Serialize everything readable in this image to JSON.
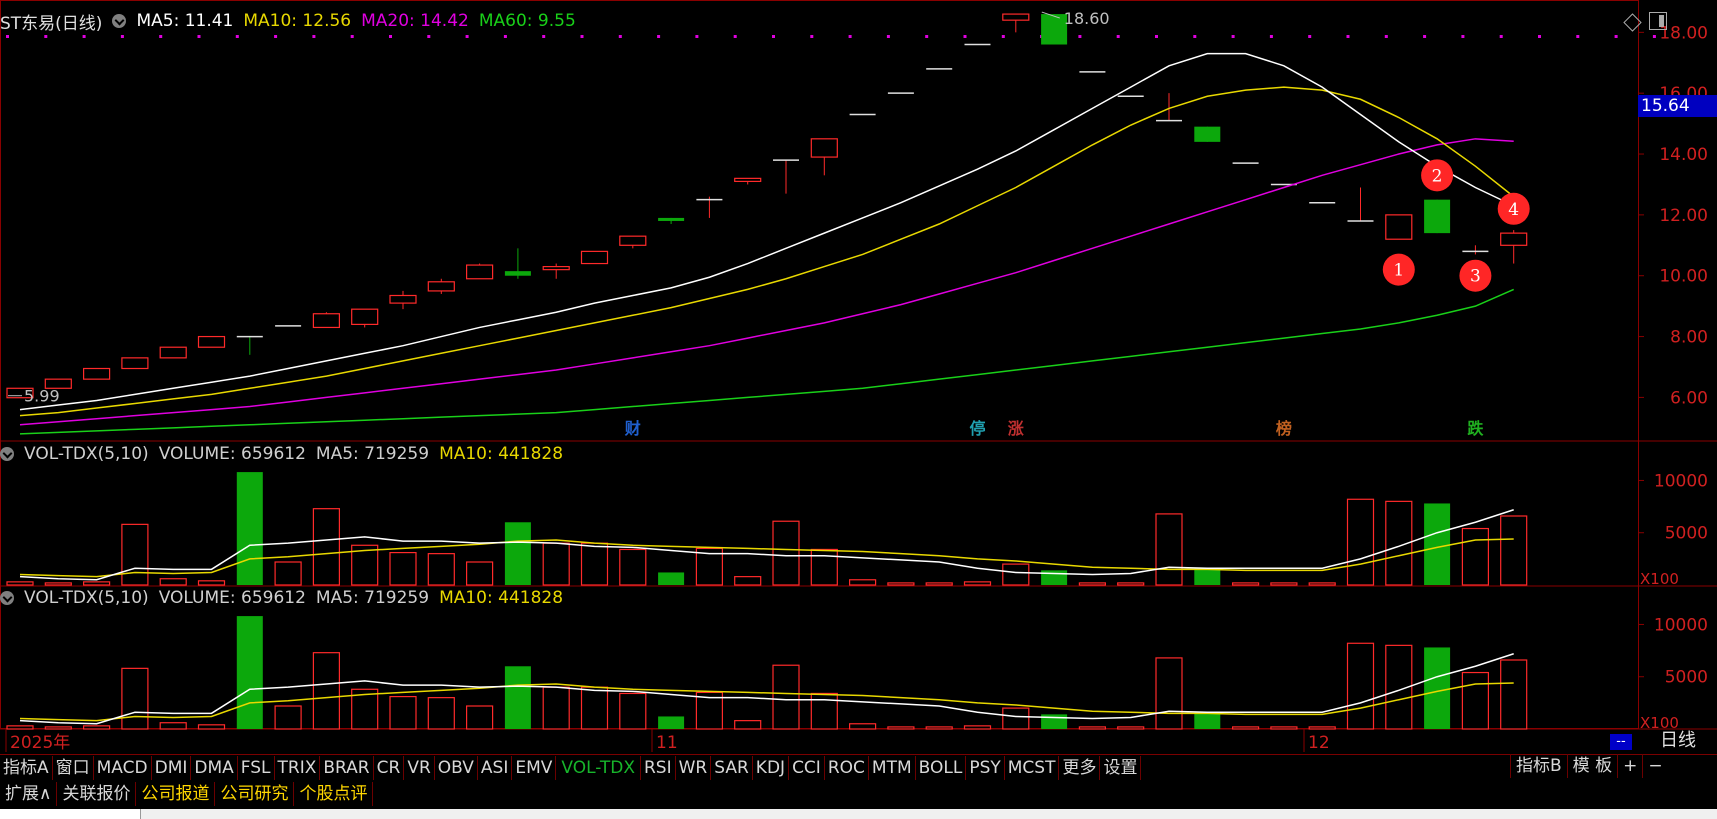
{
  "header": {
    "title": "ST东易(日线)",
    "ma5": "MA5: 11.41",
    "ma10": "MA10: 12.56",
    "ma20": "MA20: 14.42",
    "ma60": "MA60: 9.55"
  },
  "colors": {
    "up": "#ff2a2a",
    "down": "#0ca80c",
    "ma5": "#ffffff",
    "ma10": "#e8d800",
    "ma20": "#e000e0",
    "ma60": "#19d019",
    "grid_red": "#8a0000",
    "axis_text": "#d02020",
    "price_tag_bg": "#0000c0"
  },
  "current_price": "15.64",
  "high_label": "18.60",
  "low_label": "5.99",
  "price_axis": [
    "18.00",
    "16.00",
    "14.00",
    "12.00",
    "10.00",
    "8.00",
    "6.00"
  ],
  "vol_axis": [
    "10000",
    "5000"
  ],
  "vol_unit": "X100",
  "x_labels": {
    "start": "2025年",
    "nov": "11",
    "dec": "12"
  },
  "event_tags": [
    {
      "text": "财",
      "index": 16,
      "color": "#2060d0"
    },
    {
      "text": "停",
      "index": 25,
      "color": "#20a0b0"
    },
    {
      "text": "涨",
      "index": 26,
      "color": "#c03030"
    },
    {
      "text": "榜",
      "index": 33,
      "color": "#c06020"
    },
    {
      "text": "跌",
      "index": 38,
      "color": "#20b020"
    }
  ],
  "markers": [
    {
      "label": "1",
      "index": 36,
      "price": 10.2
    },
    {
      "label": "2",
      "index": 37,
      "price": 13.3
    },
    {
      "label": "3",
      "index": 38,
      "price": 10.0
    },
    {
      "label": "4",
      "index": 39,
      "price": 12.2
    }
  ],
  "indicator_headers": [
    {
      "name": "VOL-TDX(5,10)",
      "volume": "VOLUME: 659612",
      "ma5": "MA5: 719259",
      "ma10": "MA10: 441828"
    },
    {
      "name": "VOL-TDX(5,10)",
      "volume": "VOLUME: 659612",
      "ma5": "MA5: 719259",
      "ma10": "MA10: 441828"
    }
  ],
  "chart_data": {
    "type": "candlestick",
    "title": "ST东易(日线)",
    "ylim": [
      4.6,
      18.8
    ],
    "candles": [
      {
        "o": 5.99,
        "h": 6.3,
        "l": 5.99,
        "c": 6.3,
        "v": 0.3
      },
      {
        "o": 6.3,
        "h": 6.6,
        "l": 6.3,
        "c": 6.6,
        "v": 0.2
      },
      {
        "o": 6.6,
        "h": 6.95,
        "l": 6.6,
        "c": 6.95,
        "v": 0.3
      },
      {
        "o": 6.95,
        "h": 7.3,
        "l": 6.95,
        "c": 7.3,
        "v": 5.8
      },
      {
        "o": 7.3,
        "h": 7.65,
        "l": 7.3,
        "c": 7.65,
        "v": 0.6
      },
      {
        "o": 7.65,
        "h": 8.0,
        "l": 7.65,
        "c": 8.0,
        "v": 0.4
      },
      {
        "o": 8.0,
        "h": 8.0,
        "l": 7.4,
        "c": 7.95,
        "v": 10.8
      },
      {
        "o": 8.3,
        "h": 8.3,
        "l": 8.3,
        "c": 8.35,
        "v": 2.2
      },
      {
        "o": 8.3,
        "h": 8.8,
        "l": 8.3,
        "c": 8.75,
        "v": 7.3
      },
      {
        "o": 8.4,
        "h": 8.9,
        "l": 8.3,
        "c": 8.9,
        "v": 3.8
      },
      {
        "o": 9.1,
        "h": 9.5,
        "l": 8.9,
        "c": 9.35,
        "v": 3.1
      },
      {
        "o": 9.5,
        "h": 9.9,
        "l": 9.4,
        "c": 9.8,
        "v": 3.0
      },
      {
        "o": 9.9,
        "h": 10.4,
        "l": 9.9,
        "c": 10.35,
        "v": 2.2
      },
      {
        "o": 10.15,
        "h": 10.9,
        "l": 9.9,
        "c": 10.0,
        "v": 6.0
      },
      {
        "o": 10.2,
        "h": 10.4,
        "l": 9.9,
        "c": 10.3,
        "v": 4.0
      },
      {
        "o": 10.4,
        "h": 10.8,
        "l": 10.4,
        "c": 10.8,
        "v": 4.0
      },
      {
        "o": 11.0,
        "h": 11.3,
        "l": 10.9,
        "c": 11.3,
        "v": 3.4
      },
      {
        "o": 11.9,
        "h": 11.9,
        "l": 11.7,
        "c": 11.8,
        "v": 1.2
      },
      {
        "o": 12.5,
        "h": 12.6,
        "l": 11.9,
        "c": 12.5,
        "v": 3.5
      },
      {
        "o": 13.1,
        "h": 13.2,
        "l": 13.0,
        "c": 13.2,
        "v": 0.8
      },
      {
        "o": 13.8,
        "h": 13.8,
        "l": 12.7,
        "c": 13.8,
        "v": 6.1
      },
      {
        "o": 13.9,
        "h": 14.5,
        "l": 13.3,
        "c": 14.5,
        "v": 3.4
      },
      {
        "o": 15.3,
        "h": 15.3,
        "l": 15.3,
        "c": 15.3,
        "v": 0.5
      },
      {
        "o": 16.0,
        "h": 16.0,
        "l": 16.0,
        "c": 16.0,
        "v": 0.2
      },
      {
        "o": 16.8,
        "h": 16.8,
        "l": 16.8,
        "c": 16.8,
        "v": 0.2
      },
      {
        "o": 17.6,
        "h": 17.6,
        "l": 17.6,
        "c": 17.6,
        "v": 0.3
      },
      {
        "o": 18.4,
        "h": 18.6,
        "l": 18.0,
        "c": 18.6,
        "v": 2.0
      },
      {
        "o": 18.6,
        "h": 18.6,
        "l": 17.6,
        "c": 17.6,
        "v": 1.4
      },
      {
        "o": 16.7,
        "h": 16.7,
        "l": 16.7,
        "c": 16.7,
        "v": 0.2
      },
      {
        "o": 15.9,
        "h": 15.9,
        "l": 15.9,
        "c": 15.9,
        "v": 0.2
      },
      {
        "o": 15.1,
        "h": 16.0,
        "l": 15.1,
        "c": 15.1,
        "v": 6.8
      },
      {
        "o": 14.9,
        "h": 14.9,
        "l": 14.4,
        "c": 14.4,
        "v": 1.6
      },
      {
        "o": 13.7,
        "h": 13.7,
        "l": 13.7,
        "c": 13.7,
        "v": 0.2
      },
      {
        "o": 13.0,
        "h": 13.0,
        "l": 13.0,
        "c": 13.0,
        "v": 0.2
      },
      {
        "o": 12.4,
        "h": 12.4,
        "l": 12.4,
        "c": 12.4,
        "v": 0.2
      },
      {
        "o": 11.8,
        "h": 12.9,
        "l": 11.8,
        "c": 11.8,
        "v": 8.2
      },
      {
        "o": 11.2,
        "h": 12.0,
        "l": 11.2,
        "c": 12.0,
        "v": 8.0
      },
      {
        "o": 12.5,
        "h": 12.5,
        "l": 11.4,
        "c": 11.4,
        "v": 7.8
      },
      {
        "o": 10.8,
        "h": 11.0,
        "l": 10.7,
        "c": 10.8,
        "v": 5.4
      },
      {
        "o": 11.0,
        "h": 11.5,
        "l": 10.4,
        "c": 11.4,
        "v": 6.6
      }
    ],
    "ma5": [
      5.6,
      5.75,
      5.9,
      6.1,
      6.3,
      6.5,
      6.7,
      6.95,
      7.2,
      7.45,
      7.7,
      8.0,
      8.3,
      8.55,
      8.8,
      9.1,
      9.35,
      9.6,
      9.95,
      10.4,
      10.9,
      11.4,
      11.9,
      12.4,
      12.95,
      13.5,
      14.1,
      14.8,
      15.5,
      16.2,
      16.9,
      17.3,
      17.3,
      16.9,
      16.2,
      15.3,
      14.4,
      13.6,
      12.9,
      12.3
    ],
    "ma10": [
      5.4,
      5.5,
      5.65,
      5.8,
      5.95,
      6.1,
      6.3,
      6.5,
      6.7,
      6.95,
      7.2,
      7.45,
      7.7,
      7.95,
      8.2,
      8.45,
      8.7,
      8.95,
      9.25,
      9.55,
      9.9,
      10.3,
      10.7,
      11.2,
      11.7,
      12.3,
      12.9,
      13.6,
      14.3,
      14.95,
      15.5,
      15.9,
      16.1,
      16.2,
      16.1,
      15.8,
      15.2,
      14.5,
      13.6,
      12.6
    ],
    "ma20": [
      5.1,
      5.2,
      5.3,
      5.4,
      5.5,
      5.6,
      5.7,
      5.85,
      6.0,
      6.15,
      6.3,
      6.45,
      6.6,
      6.75,
      6.9,
      7.1,
      7.3,
      7.5,
      7.7,
      7.95,
      8.2,
      8.45,
      8.75,
      9.05,
      9.4,
      9.75,
      10.1,
      10.5,
      10.9,
      11.3,
      11.7,
      12.1,
      12.5,
      12.9,
      13.3,
      13.65,
      14.0,
      14.3,
      14.5,
      14.42
    ],
    "ma60": [
      4.8,
      4.85,
      4.9,
      4.95,
      5.0,
      5.05,
      5.1,
      5.15,
      5.2,
      5.25,
      5.3,
      5.35,
      5.4,
      5.45,
      5.5,
      5.6,
      5.7,
      5.8,
      5.9,
      6.0,
      6.1,
      6.2,
      6.3,
      6.45,
      6.6,
      6.75,
      6.9,
      7.05,
      7.2,
      7.35,
      7.5,
      7.65,
      7.8,
      7.95,
      8.1,
      8.25,
      8.45,
      8.7,
      9.0,
      9.55
    ],
    "vol_ma5": [
      0.8,
      0.6,
      0.5,
      1.6,
      1.5,
      1.5,
      3.8,
      4.0,
      4.3,
      4.6,
      4.2,
      4.2,
      4.0,
      4.1,
      4.0,
      3.7,
      3.6,
      3.3,
      3.0,
      3.0,
      2.8,
      2.8,
      2.6,
      2.4,
      2.2,
      1.6,
      1.2,
      1.1,
      1.0,
      1.1,
      1.7,
      1.6,
      1.6,
      1.6,
      1.6,
      2.5,
      3.7,
      5.0,
      6.0,
      7.2
    ],
    "vol_ma10": [
      1.0,
      0.9,
      0.8,
      1.2,
      1.1,
      1.2,
      2.5,
      2.7,
      3.0,
      3.3,
      3.5,
      3.7,
      3.9,
      4.2,
      4.3,
      4.0,
      3.8,
      3.7,
      3.6,
      3.5,
      3.4,
      3.3,
      3.2,
      3.0,
      2.8,
      2.5,
      2.3,
      2.0,
      1.7,
      1.6,
      1.5,
      1.5,
      1.4,
      1.4,
      1.4,
      2.0,
      2.8,
      3.6,
      4.3,
      4.4
    ],
    "vol_ylim": [
      0,
      11.0
    ]
  },
  "tabs_row1": [
    "指标A",
    "窗口",
    "MACD",
    "DMI",
    "DMA",
    "FSL",
    "TRIX",
    "BRAR",
    "CR",
    "VR",
    "OBV",
    "ASI",
    "EMV",
    "VOL-TDX",
    "RSI",
    "WR",
    "SAR",
    "KDJ",
    "CCI",
    "ROC",
    "MTM",
    "BOLL",
    "PSY",
    "MCST",
    "更多",
    "设置"
  ],
  "active_tab": "VOL-TDX",
  "tabs_row1_right": [
    "指标B",
    "模 板",
    "+",
    "−"
  ],
  "tabs_row2": [
    "扩展∧",
    "关联报价",
    "公司报道",
    "公司研究",
    "个股点评"
  ],
  "day_button": "日线",
  "dash_badge": "--"
}
